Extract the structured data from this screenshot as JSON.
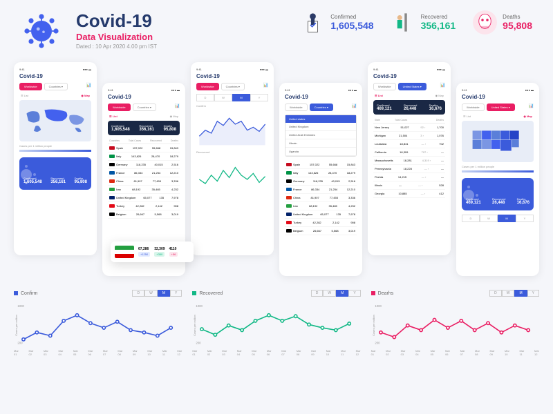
{
  "header": {
    "title": "Covid-19",
    "subtitle": "Data Visualization",
    "date": "Dated : 10 Apr 2020 4.00 pm IST"
  },
  "top_stats": {
    "confirmed_label": "Confirmed",
    "confirmed": "1,605,548",
    "recovered_label": "Recovered",
    "recovered": "356,161",
    "deaths_label": "Deaths",
    "deaths": "95,808"
  },
  "phone_common": {
    "time": "9:41",
    "title": "Covid-19",
    "worldwide": "Worldwide",
    "countries": "Countries",
    "united_states": "United States",
    "list": "List",
    "map": "Map",
    "cases_per_million": "Cases per 1 million people",
    "d": "D",
    "w": "W",
    "m": "M",
    "y": "Y"
  },
  "bluecard": {
    "confirmed_l": "Confirmed",
    "confirmed": "1,605,548",
    "recovered_l": "Recovered",
    "recovered": "356,161",
    "deaths_l": "Deaths",
    "deaths": "95,808"
  },
  "us_card": {
    "confirmed_l": "Confirmed",
    "confirmed": "469,121",
    "recovered_l": "Recovered",
    "recovered": "26,448",
    "deaths_l": "Deaths",
    "deaths": "16,676"
  },
  "countries_table": {
    "headers": {
      "country": "Countries",
      "total": "Total Cases",
      "rec": "Recovered",
      "death": "Deaths"
    },
    "rows": [
      {
        "name": "Spain",
        "total": "157,022",
        "rec": "55,668",
        "death": "15,843",
        "flag": "#c60b1e"
      },
      {
        "name": "Italy",
        "total": "143,626",
        "rec": "28,470",
        "death": "18,279",
        "flag": "#009246"
      },
      {
        "name": "Germany",
        "total": "118,235",
        "rec": "40,015",
        "death": "2,516",
        "flag": "#000"
      },
      {
        "name": "France",
        "total": "86,334",
        "rec": "21,254",
        "death": "12,210",
        "flag": "#0055a4"
      },
      {
        "name": "China",
        "total": "81,907",
        "rec": "77,455",
        "death": "3,336",
        "flag": "#de2910"
      },
      {
        "name": "Iran",
        "total": "68,192",
        "rec": "35,465",
        "death": "4,232",
        "flag": "#239f40"
      },
      {
        "name": "United Kingdom",
        "total": "65,077",
        "rec": "135",
        "death": "7,978",
        "flag": "#012169"
      },
      {
        "name": "Turkey",
        "total": "42,282",
        "rec": "2,142",
        "death": "908",
        "flag": "#e30a17"
      },
      {
        "name": "Belgium",
        "total": "26,667",
        "rec": "5,568",
        "death": "3,019",
        "flag": "#000"
      }
    ]
  },
  "dropdown": {
    "selected": "United states",
    "items": [
      "United Kingdom",
      "United Arab Emirates",
      "Ukrain",
      "Uganda"
    ]
  },
  "states_table": {
    "headers": {
      "state": "State",
      "total": "Total Cases",
      "death": "Deaths"
    },
    "rows": [
      {
        "name": "New Jersey",
        "total": "51,027",
        "d": "92",
        "death": "1,700"
      },
      {
        "name": "Michigan",
        "total": "21,504",
        "d": "3",
        "death": "1,076"
      },
      {
        "name": "Louisiana",
        "total": "18,841",
        "d": "—",
        "death": "702"
      },
      {
        "name": "California",
        "total": "18,309",
        "d": "707",
        "death": "—"
      },
      {
        "name": "Massachusetts",
        "total": "18,281",
        "d": "4,319",
        "death": "—"
      },
      {
        "name": "Pennsylvania",
        "total": "18,228",
        "d": "—",
        "death": "—"
      },
      {
        "name": "Florida",
        "total": "14,215",
        "d": "—",
        "death": "—"
      },
      {
        "name": "Illinois",
        "total": "—",
        "d": "—",
        "death": "528"
      },
      {
        "name": "Georgia",
        "total": "10,885",
        "d": "—",
        "death": "412"
      }
    ]
  },
  "popup": {
    "total": "67,286",
    "rec": "32,309",
    "death": "4110",
    "d_total": "+1250",
    "d_rec": "+350",
    "d_death": "+56"
  },
  "bottom": {
    "confirm_title": "Confirm",
    "recovered_title": "Recovered",
    "deaths_title": "Dearhs",
    "ylabel": "Cases per million"
  },
  "chart_sections": {
    "confirm": "Confirm",
    "recovered": "Recovered"
  },
  "chart_data": [
    {
      "type": "line",
      "title": "Confirm",
      "ylabel": "Cases per million",
      "ylim": [
        200,
        1000
      ],
      "categories": [
        "Mar 01",
        "Mar 02",
        "Mar 03",
        "Mar 04",
        "Mar 05",
        "Mar 06",
        "Mar 07",
        "Mar 08",
        "Mar 09",
        "Mar 10",
        "Mar 11",
        "Mar 12"
      ],
      "values": [
        300,
        450,
        380,
        700,
        820,
        650,
        550,
        680,
        500,
        450,
        380,
        550
      ],
      "color": "#3b5bdb"
    },
    {
      "type": "line",
      "title": "Recovered",
      "ylabel": "Cases per million",
      "ylim": [
        200,
        1000
      ],
      "categories": [
        "Mar 01",
        "Mar 02",
        "Mar 03",
        "Mar 04",
        "Mar 05",
        "Mar 06",
        "Mar 07",
        "Mar 08",
        "Mar 09",
        "Mar 10",
        "Mar 11",
        "Mar 12"
      ],
      "values": [
        520,
        400,
        600,
        500,
        700,
        820,
        700,
        800,
        620,
        550,
        500,
        640
      ],
      "color": "#12b886"
    },
    {
      "type": "line",
      "title": "Dearhs",
      "ylabel": "Cases per million",
      "ylim": [
        200,
        1000
      ],
      "categories": [
        "Mar 01",
        "Mar 02",
        "Mar 03",
        "Mar 04",
        "Mar 05",
        "Mar 06",
        "Mar 07",
        "Mar 08",
        "Mar 09",
        "Mar 10",
        "Mar 11",
        "Mar 12"
      ],
      "values": [
        450,
        350,
        600,
        500,
        720,
        550,
        700,
        500,
        650,
        450,
        600,
        500
      ],
      "color": "#e91e63"
    }
  ]
}
